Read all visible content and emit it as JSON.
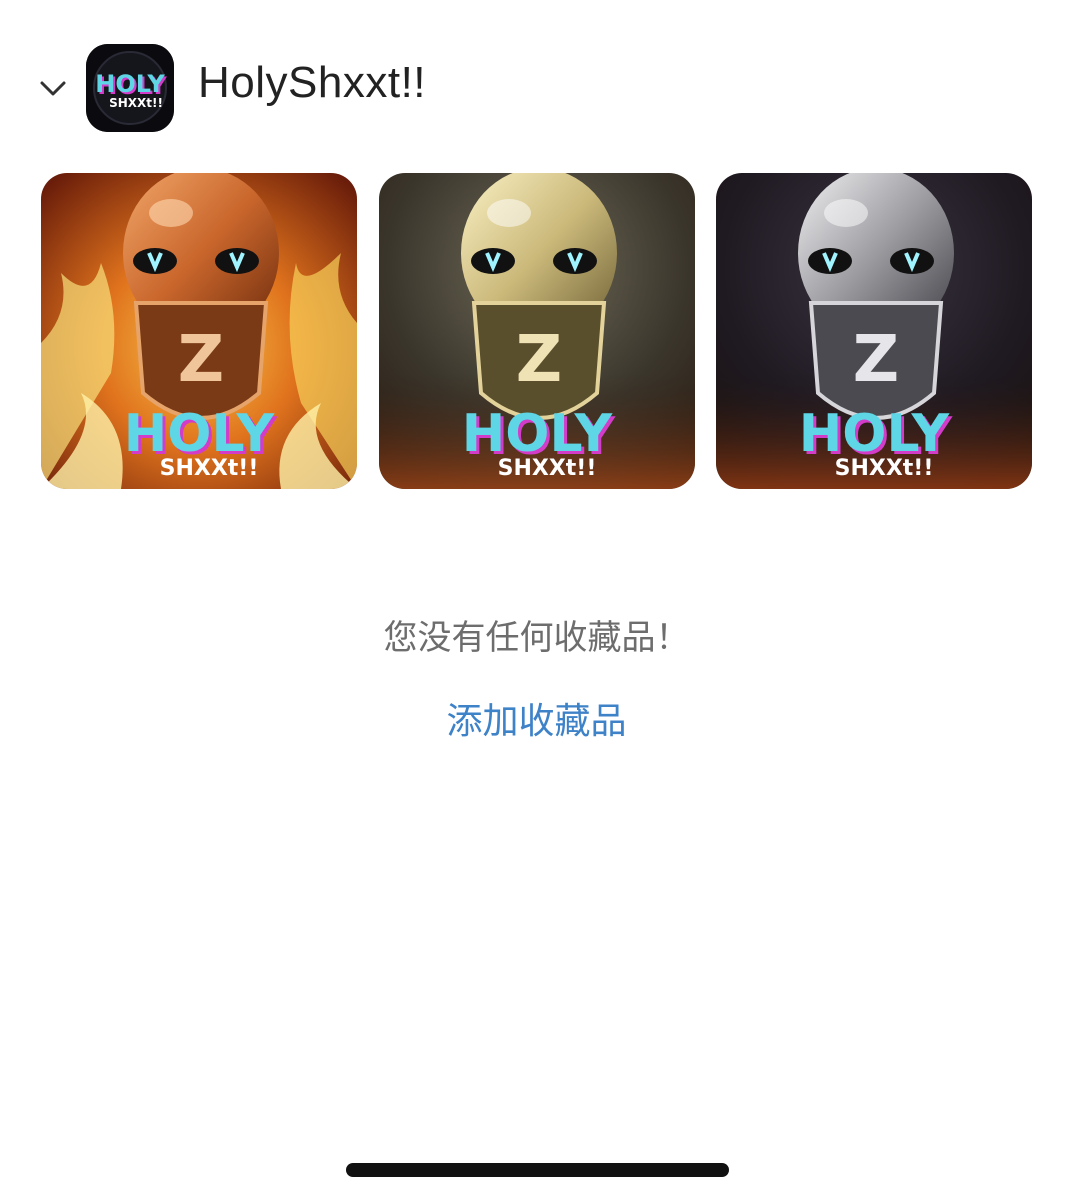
{
  "header": {
    "collapse_icon": "chevron-down-icon",
    "collection_name": "HolySHxxt!!",
    "title": "HolyShxxt!!"
  },
  "collection_items": [
    {
      "variant": "flame",
      "logo_top": "HOLY",
      "logo_bottom": "SHXXt!!",
      "accent": "#e2701f"
    },
    {
      "variant": "gold",
      "logo_top": "HOLY",
      "logo_bottom": "SHXXt!!",
      "accent": "#c8b77a"
    },
    {
      "variant": "silver",
      "logo_top": "HOLY",
      "logo_bottom": "SHXXt!!",
      "accent": "#9a9a9e"
    }
  ],
  "empty_state": {
    "message": "您没有任何收藏品！",
    "add_link": "添加收藏品"
  },
  "colors": {
    "link": "#3e82c8",
    "muted_text": "#6d6d6d",
    "logo_cyan": "#5fd6e6",
    "logo_magenta": "#d23cc9"
  }
}
